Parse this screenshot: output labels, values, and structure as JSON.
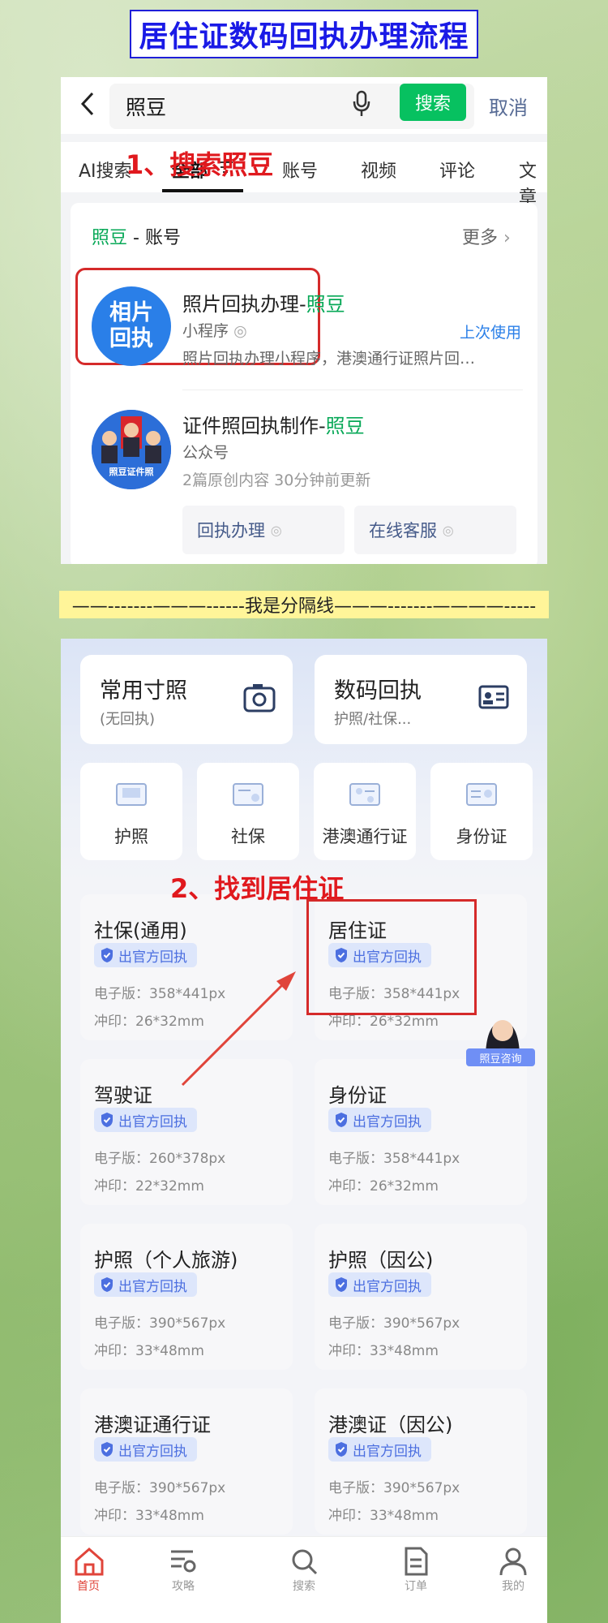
{
  "title": "居住证数码回执办理流程",
  "search": {
    "query": "照豆",
    "button": "搜索",
    "cancel": "取消"
  },
  "tabs": [
    "AI搜索",
    "全部",
    "账号",
    "视频",
    "评论",
    "文章"
  ],
  "account_section": {
    "prefix": "照豆",
    "suffix": " - 账号",
    "more": "更多",
    "step_label": "1、搜索照豆"
  },
  "results": [
    {
      "logo_line1": "相片",
      "logo_line2": "回执",
      "title_prefix": "照片回执办理-",
      "title_highlight": "照豆",
      "type": "小程序",
      "badge": "上次使用",
      "desc": "照片回执办理小程序，港澳通行证照片回…"
    },
    {
      "logo_text": "照豆证件照",
      "title_prefix": "证件照回执制作-",
      "title_highlight": "照豆",
      "type": "公众号",
      "desc": "2篇原创内容  30分钟前更新",
      "buttons": [
        "回执办理",
        "在线客服"
      ]
    }
  ],
  "divider": "——-------———------我是分隔线———-------————-----",
  "top_cards": [
    {
      "title": "常用寸照",
      "sub": "(无回执)"
    },
    {
      "title": "数码回执",
      "sub": "护照/社保..."
    }
  ],
  "categories": [
    "护照",
    "社保",
    "港澳通行证",
    "身份证"
  ],
  "step2_label": "2、找到居住证",
  "docs": [
    {
      "name": "社保(通用)",
      "badge": "出官方回执",
      "digital": "电子版：358*441px",
      "print": "冲印：26*32mm"
    },
    {
      "name": "居住证",
      "badge": "出官方回执",
      "digital": "电子版：358*441px",
      "print": "冲印：26*32mm"
    },
    {
      "name": "驾驶证",
      "badge": "出官方回执",
      "digital": "电子版：260*378px",
      "print": "冲印：22*32mm"
    },
    {
      "name": "身份证",
      "badge": "出官方回执",
      "digital": "电子版：358*441px",
      "print": "冲印：26*32mm"
    },
    {
      "name": "护照（个人旅游)",
      "badge": "出官方回执",
      "digital": "电子版：390*567px",
      "print": "冲印：33*48mm"
    },
    {
      "name": "护照（因公)",
      "badge": "出官方回执",
      "digital": "电子版：390*567px",
      "print": "冲印：33*48mm"
    },
    {
      "name": "港澳证通行证",
      "badge": "出官方回执",
      "digital": "电子版：390*567px",
      "print": "冲印：33*48mm"
    },
    {
      "name": "港澳证（因公)",
      "badge": "出官方回执",
      "digital": "电子版：390*567px",
      "print": "冲印：33*48mm"
    }
  ],
  "consult": "照豆咨询",
  "nav": [
    "首页",
    "攻略",
    "搜索",
    "订单",
    "我的"
  ],
  "colors": {
    "wechat_green": "#07c160",
    "annotation_red": "#e0191e",
    "title_blue": "#1a1ae6",
    "badge_blue": "#4c6fe0"
  }
}
